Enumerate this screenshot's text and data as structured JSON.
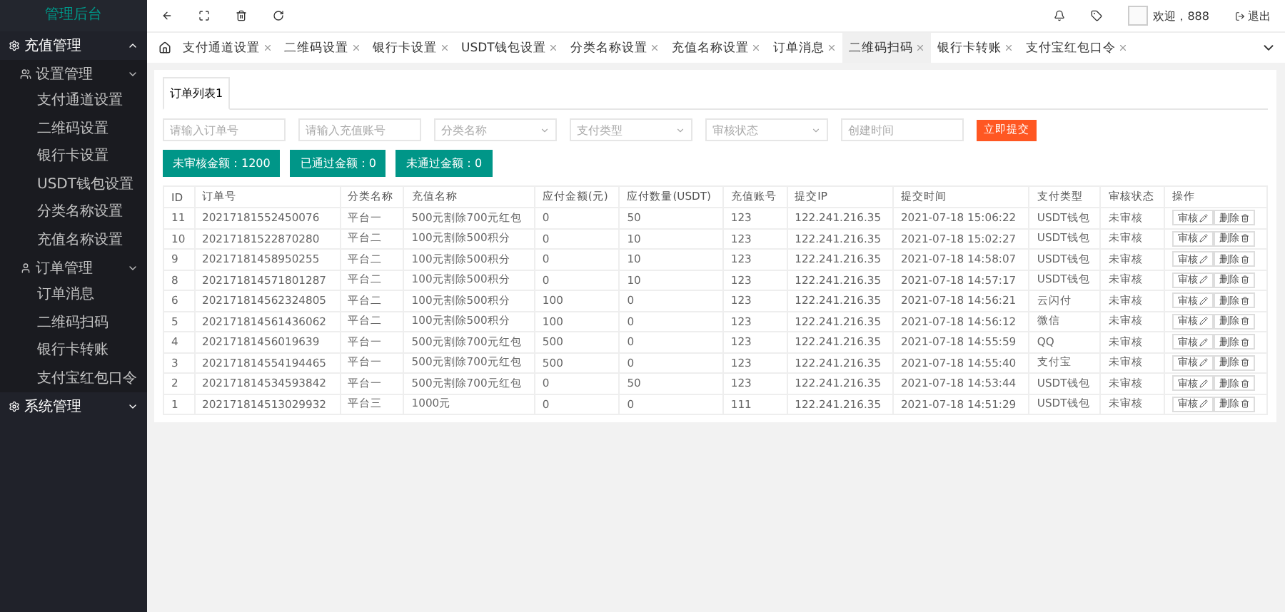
{
  "sidebar": {
    "title": "管理后台",
    "groups": [
      {
        "label": "充值管理",
        "expanded": true,
        "children": [
          {
            "label": "设置管理",
            "expanded": true,
            "children": [
              {
                "label": "支付通道设置"
              },
              {
                "label": "二维码设置"
              },
              {
                "label": "银行卡设置"
              },
              {
                "label": "USDT钱包设置"
              },
              {
                "label": "分类名称设置"
              },
              {
                "label": "充值名称设置"
              }
            ]
          },
          {
            "label": "订单管理",
            "expanded": true,
            "children": [
              {
                "label": "订单消息"
              },
              {
                "label": "二维码扫码"
              },
              {
                "label": "银行卡转账"
              },
              {
                "label": "支付宝红包口令"
              }
            ]
          }
        ]
      },
      {
        "label": "系统管理",
        "expanded": false
      }
    ]
  },
  "header": {
    "welcome": "欢迎，888",
    "logout": "退出"
  },
  "tabs": [
    {
      "label": "支付通道设置",
      "selected": false
    },
    {
      "label": "二维码设置",
      "selected": false
    },
    {
      "label": "银行卡设置",
      "selected": false
    },
    {
      "label": "USDT钱包设置",
      "selected": false
    },
    {
      "label": "分类名称设置",
      "selected": false
    },
    {
      "label": "充值名称设置",
      "selected": false
    },
    {
      "label": "订单消息",
      "selected": false
    },
    {
      "label": "二维码扫码",
      "selected": true
    },
    {
      "label": "银行卡转账",
      "selected": false
    },
    {
      "label": "支付宝红包口令",
      "selected": false
    }
  ],
  "panel_tab": "订单列表1",
  "filters": [
    {
      "kind": "input",
      "placeholder": "请输入订单号"
    },
    {
      "kind": "input",
      "placeholder": "请输入充值账号"
    },
    {
      "kind": "select",
      "placeholder": "分类名称"
    },
    {
      "kind": "select",
      "placeholder": "支付类型"
    },
    {
      "kind": "select",
      "placeholder": "审核状态"
    },
    {
      "kind": "input",
      "placeholder": "创建时间"
    }
  ],
  "submit": "立即提交",
  "stats": [
    "未审核金额：1200",
    "已通过金额：0",
    "未通过金额：0"
  ],
  "table": {
    "columns": [
      "ID",
      "订单号",
      "分类名称",
      "充值名称",
      "应付金额(元)",
      "应付数量(USDT)",
      "充值账号",
      "提交IP",
      "提交时间",
      "支付类型",
      "审核状态",
      "操作"
    ],
    "rows": [
      {
        "cells": [
          "11",
          "20217181552450076",
          "平台一",
          "500元割除700元红包",
          "0",
          "50",
          "123",
          "122.241.216.35",
          "2021-07-18 15:06:22",
          "USDT钱包",
          "未审核"
        ],
        "actions": [
          "审核",
          "删除"
        ]
      },
      {
        "cells": [
          "10",
          "20217181522870280",
          "平台二",
          "100元割除500积分",
          "0",
          "10",
          "123",
          "122.241.216.35",
          "2021-07-18 15:02:27",
          "USDT钱包",
          "未审核"
        ],
        "actions": [
          "审核",
          "删除"
        ]
      },
      {
        "cells": [
          "9",
          "20217181458950255",
          "平台二",
          "100元割除500积分",
          "0",
          "10",
          "123",
          "122.241.216.35",
          "2021-07-18 14:58:07",
          "USDT钱包",
          "未审核"
        ],
        "actions": [
          "审核",
          "删除"
        ]
      },
      {
        "cells": [
          "8",
          "202171814571801287",
          "平台二",
          "100元割除500积分",
          "0",
          "10",
          "123",
          "122.241.216.35",
          "2021-07-18 14:57:17",
          "USDT钱包",
          "未审核"
        ],
        "actions": [
          "审核",
          "删除"
        ]
      },
      {
        "cells": [
          "6",
          "202171814562324805",
          "平台二",
          "100元割除500积分",
          "100",
          "0",
          "123",
          "122.241.216.35",
          "2021-07-18 14:56:21",
          "云闪付",
          "未审核"
        ],
        "actions": [
          "审核",
          "删除"
        ]
      },
      {
        "cells": [
          "5",
          "202171814561436062",
          "平台二",
          "100元割除500积分",
          "100",
          "0",
          "123",
          "122.241.216.35",
          "2021-07-18 14:56:12",
          "微信",
          "未审核"
        ],
        "actions": [
          "审核",
          "删除"
        ]
      },
      {
        "cells": [
          "4",
          "20217181456019639",
          "平台一",
          "500元割除700元红包",
          "500",
          "0",
          "123",
          "122.241.216.35",
          "2021-07-18 14:55:59",
          "QQ",
          "未审核"
        ],
        "actions": [
          "审核",
          "删除"
        ]
      },
      {
        "cells": [
          "3",
          "202171814554194465",
          "平台一",
          "500元割除700元红包",
          "500",
          "0",
          "123",
          "122.241.216.35",
          "2021-07-18 14:55:40",
          "支付宝",
          "未审核"
        ],
        "actions": [
          "审核",
          "删除"
        ]
      },
      {
        "cells": [
          "2",
          "202171814534593842",
          "平台一",
          "500元割除700元红包",
          "0",
          "50",
          "123",
          "122.241.216.35",
          "2021-07-18 14:53:44",
          "USDT钱包",
          "未审核"
        ],
        "actions": [
          "审核",
          "删除"
        ]
      },
      {
        "cells": [
          "1",
          "202171814513029932",
          "平台三",
          "1000元",
          "0",
          "0",
          "111",
          "122.241.216.35",
          "2021-07-18 14:51:29",
          "USDT钱包",
          "未审核"
        ],
        "actions": [
          "审核",
          "删除"
        ]
      }
    ]
  }
}
